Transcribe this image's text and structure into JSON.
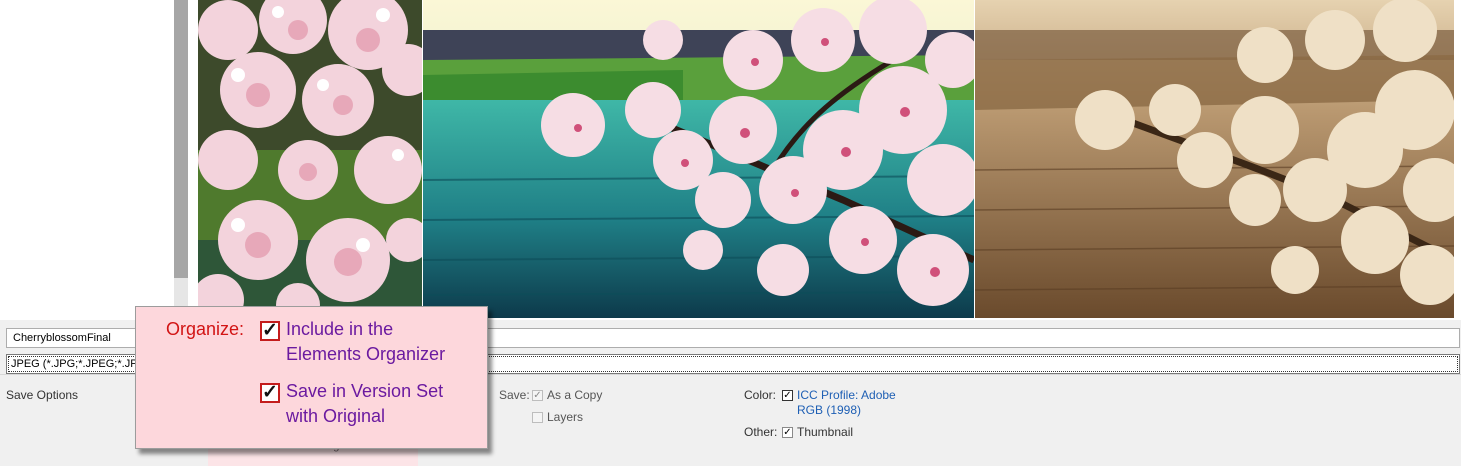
{
  "file": {
    "name_value": "CherryblossomFinal",
    "format_value": "JPEG (*.JPG;*.JPEG;*.JPE"
  },
  "save_options": {
    "section_label": "Save Options",
    "save_label": "Save:",
    "as_a_copy": {
      "label": "As a Copy",
      "checked": true,
      "enabled": false
    },
    "layers": {
      "label": "Layers",
      "checked": false,
      "enabled": false
    },
    "color_label": "Color:",
    "icc_profile": {
      "line1": "ICC Profile:  Adobe",
      "line2": "RGB (1998)",
      "checked": true
    },
    "other_label": "Other:",
    "thumbnail": {
      "label": "Thumbnail",
      "checked": true
    }
  },
  "callout": {
    "organize_label": "Organize:",
    "include_organizer": {
      "line1": "Include in the",
      "line2": "Elements Organizer",
      "checked": true
    },
    "version_set": {
      "line1": "Save in Version Set",
      "line2": "with Original",
      "checked": true
    },
    "ghost_text": "with Original"
  },
  "preview": {
    "thumbnails": [
      "photo-original-crop-icon",
      "photo-vivid-teal-icon",
      "photo-sepia-icon"
    ]
  },
  "colors": {
    "callout_bg": "#fdd7dc",
    "organize_red": "#d21414",
    "callout_text_purple": "#6b1aa0",
    "link_blue": "#1e5fb4"
  }
}
